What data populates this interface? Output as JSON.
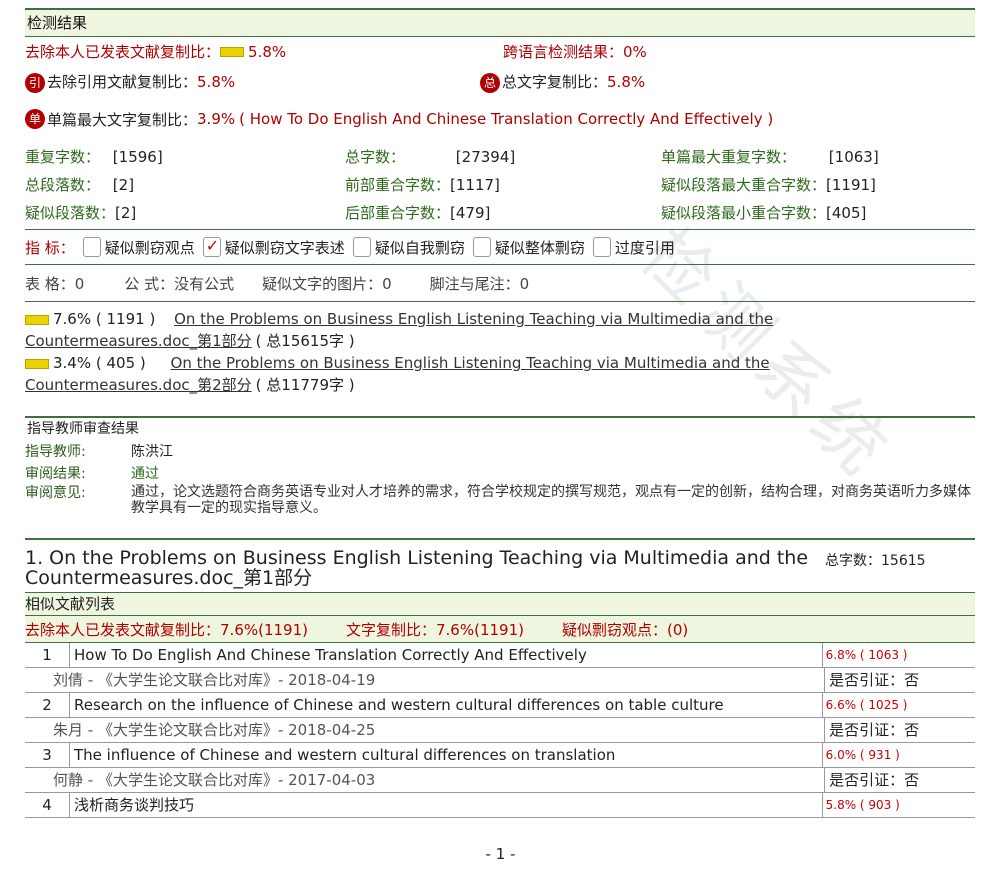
{
  "watermark": "检测系统",
  "detect": {
    "header": "检测结果",
    "self_label": "去除本人已发表文献复制比：",
    "self_value": "5.8%",
    "cross_label": "跨语言检测结果：",
    "cross_value": "0%",
    "cite_badge": "引",
    "cite_label": "去除引用文献复制比：",
    "cite_value": "5.8%",
    "total_badge": "总",
    "total_label": "总文字复制比：",
    "total_value": "5.8%",
    "single_badge": "单",
    "single_label": "单篇最大文字复制比：",
    "single_value": "3.9%",
    "single_title": "( How To Do English And Chinese Translation Correctly And Effectively )"
  },
  "stats": [
    {
      "label": "重复字数：",
      "value": "[1596]"
    },
    {
      "label": "总字数：",
      "value": "[27394]"
    },
    {
      "label": "单篇最大重复字数：",
      "value": "[1063]"
    },
    {
      "label": "总段落数：",
      "value": "[2]"
    },
    {
      "label": "前部重合字数：",
      "value": "[1117]"
    },
    {
      "label": "疑似段落最大重合字数：",
      "value": "[1191]"
    },
    {
      "label": "疑似段落数：",
      "value": "[2]"
    },
    {
      "label": "后部重合字数：",
      "value": "[479]"
    },
    {
      "label": "疑似段落最小重合字数：",
      "value": "[405]"
    }
  ],
  "indicators": {
    "label": "指 标：",
    "items": [
      {
        "text": "疑似剽窃观点",
        "checked": false
      },
      {
        "text": "疑似剽窃文字表述",
        "checked": true
      },
      {
        "text": "疑似自我剽窃",
        "checked": false
      },
      {
        "text": "疑似整体剽窃",
        "checked": false
      },
      {
        "text": "过度引用",
        "checked": false
      }
    ]
  },
  "misc": {
    "table": "表 格：0",
    "formula": "公 式：没有公式",
    "image": "疑似文字的图片：0",
    "footnote": "脚注与尾注：0"
  },
  "parts": [
    {
      "pct": "7.6% ( 1191 )",
      "title_a": "On the Problems on Business English Listening Teaching via Multimedia and the",
      "title_b": "Countermeasures.doc_第1部分",
      "total": "( 总15615字 )"
    },
    {
      "pct": "3.4% ( 405 )",
      "title_a": "On the Problems on Business English Listening Teaching via Multimedia and the",
      "title_b": "Countermeasures.doc_第2部分",
      "total": "( 总11779字 )"
    }
  ],
  "review": {
    "header": "指导教师审查结果",
    "teacher_label": "指导教师:",
    "teacher": "陈洪江",
    "result_label": "审阅结果:",
    "result": "通过",
    "opinion_label": "审阅意见:",
    "opinion": "通过，论文选题符合商务英语专业对人才培养的需求，符合学校规定的撰写规范，观点有一定的创新，结构合理，对商务英语听力多媒体教学具有一定的现实指导意义。"
  },
  "section1": {
    "title_a": "1. On the Problems on Business English Listening Teaching via Multimedia and the",
    "title_b": "Countermeasures.doc_第1部分",
    "total": "总字数：15615",
    "list_header": "相似文献列表",
    "summary_self": "去除本人已发表文献复制比：7.6%(1191)",
    "summary_text": "文字复制比：7.6%(1191)",
    "summary_view": "疑似剽窃观点：(0)"
  },
  "similar": [
    {
      "no": "1",
      "title": "How To Do English And Chinese Translation Correctly And Effectively",
      "pct": "6.8% ( 1063 )",
      "meta": "刘倩 - 《大学生论文联合比对库》- 2018-04-19",
      "cite": "是否引证：否"
    },
    {
      "no": "2",
      "title": "Research on the influence of Chinese and western cultural differences on table culture",
      "pct": "6.6% ( 1025 )",
      "meta": "朱月 - 《大学生论文联合比对库》- 2018-04-25",
      "cite": "是否引证：否"
    },
    {
      "no": "3",
      "title": "The influence of Chinese and western cultural differences on translation",
      "pct": "6.0% ( 931 )",
      "meta": "何静 - 《大学生论文联合比对库》- 2017-04-03",
      "cite": "是否引证：否"
    },
    {
      "no": "4",
      "title": "浅析商务谈判技巧",
      "pct": "5.8% ( 903 )",
      "meta": "",
      "cite": ""
    }
  ],
  "page_number": "- 1 -"
}
